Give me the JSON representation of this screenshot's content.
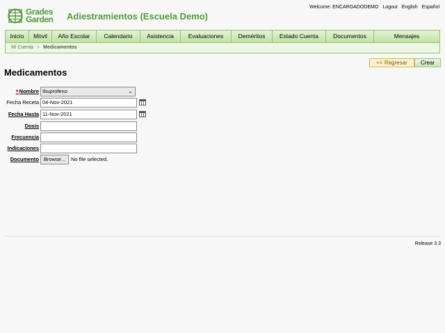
{
  "header": {
    "logo_line1": "Grades",
    "logo_line2": "Garden",
    "app_title": "Adiestramientos (Escuela Demo)",
    "welcome": "Welcome: ENCARGADODEMO",
    "logout": "Logout",
    "lang_english": "English",
    "lang_spanish": "Español"
  },
  "nav": {
    "items": [
      "Inicio",
      "Móvil",
      "Año Escolar",
      "Calendario",
      "Asistencia",
      "Evaluaciones",
      "Deméritos",
      "Estado Cuenta",
      "Documentos",
      "Mensajes"
    ]
  },
  "breadcrumb": {
    "parent": "Mi Cuenta",
    "separator": ">",
    "current": "Medicamentos"
  },
  "actions": {
    "back_label": "<< Regresar",
    "create_label": "Crear"
  },
  "page": {
    "title": "Medicamentos"
  },
  "form": {
    "nombre_label": "Nombre",
    "nombre_value": "Ibuprofeno",
    "fecha_receta_label": "Fecha Receta",
    "fecha_receta_value": "04-Nov-2021",
    "fecha_hasta_label": "Fecha Hasta",
    "fecha_hasta_value": "11-Nov-2021",
    "dosis_label": "Dosis",
    "dosis_value": "",
    "frecuencia_label": "Frecuencia",
    "frecuencia_value": "",
    "indicaciones_label": "Indicaciones",
    "indicaciones_value": "",
    "documento_label": "Documento",
    "browse_label": "Browse...",
    "no_file_text": "No file selected."
  },
  "footer": {
    "release": "Release 3.3"
  },
  "colors": {
    "brand_green": "#4f9a34",
    "nav_border": "#94c476"
  }
}
